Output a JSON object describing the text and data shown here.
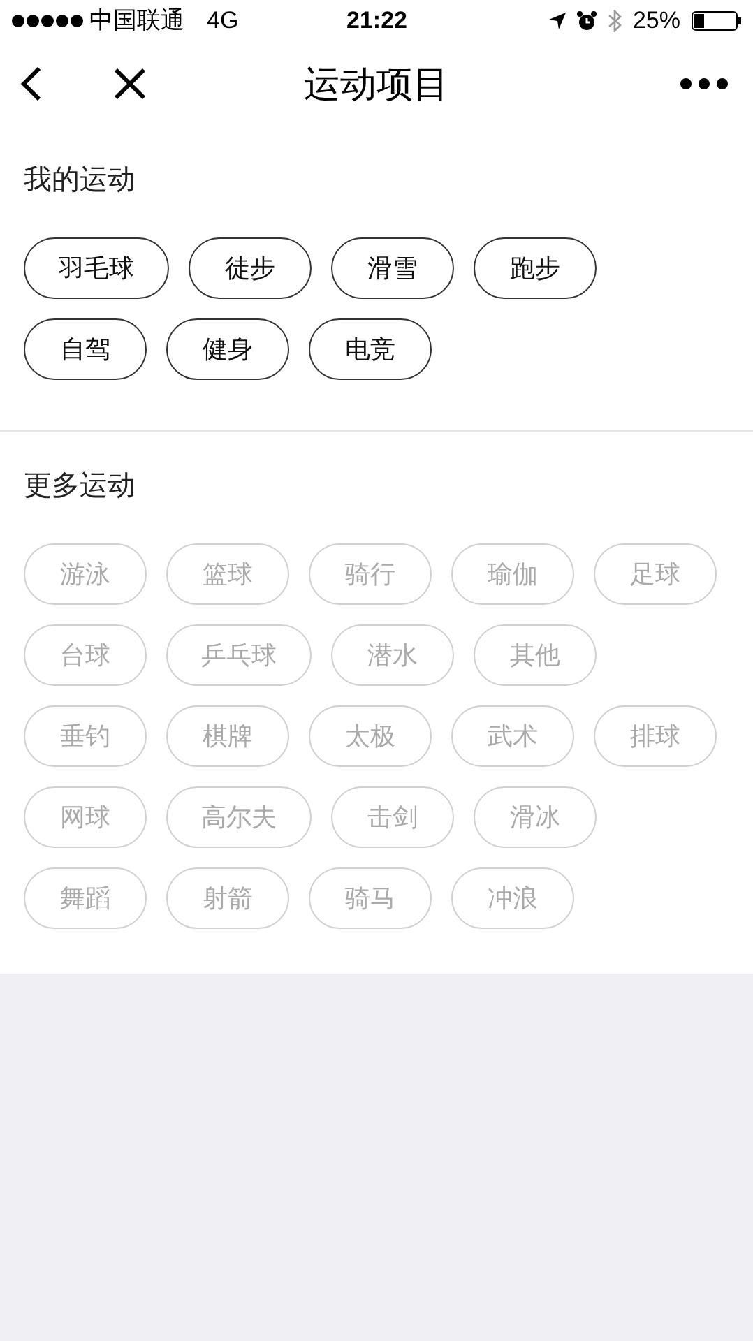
{
  "status_bar": {
    "carrier": "中国联通",
    "network": "4G",
    "time": "21:22",
    "battery": "25%"
  },
  "nav": {
    "title": "运动项目"
  },
  "sections": [
    {
      "title": "我的运动",
      "tags": [
        {
          "label": "羽毛球",
          "selected": true
        },
        {
          "label": "徒步",
          "selected": true
        },
        {
          "label": "滑雪",
          "selected": true
        },
        {
          "label": "跑步",
          "selected": true
        },
        {
          "label": "自驾",
          "selected": true
        },
        {
          "label": "健身",
          "selected": true
        },
        {
          "label": "电竞",
          "selected": true
        }
      ]
    },
    {
      "title": "更多运动",
      "tags": [
        {
          "label": "游泳",
          "selected": false
        },
        {
          "label": "篮球",
          "selected": false
        },
        {
          "label": "骑行",
          "selected": false
        },
        {
          "label": "瑜伽",
          "selected": false
        },
        {
          "label": "足球",
          "selected": false
        },
        {
          "label": "台球",
          "selected": false
        },
        {
          "label": "乒乓球",
          "selected": false
        },
        {
          "label": "潜水",
          "selected": false
        },
        {
          "label": "其他",
          "selected": false
        },
        {
          "label": "垂钓",
          "selected": false
        },
        {
          "label": "棋牌",
          "selected": false
        },
        {
          "label": "太极",
          "selected": false
        },
        {
          "label": "武术",
          "selected": false
        },
        {
          "label": "排球",
          "selected": false
        },
        {
          "label": "网球",
          "selected": false
        },
        {
          "label": "高尔夫",
          "selected": false
        },
        {
          "label": "击剑",
          "selected": false
        },
        {
          "label": "滑冰",
          "selected": false
        },
        {
          "label": "舞蹈",
          "selected": false
        },
        {
          "label": "射箭",
          "selected": false
        },
        {
          "label": "骑马",
          "selected": false
        },
        {
          "label": "冲浪",
          "selected": false
        }
      ]
    }
  ]
}
